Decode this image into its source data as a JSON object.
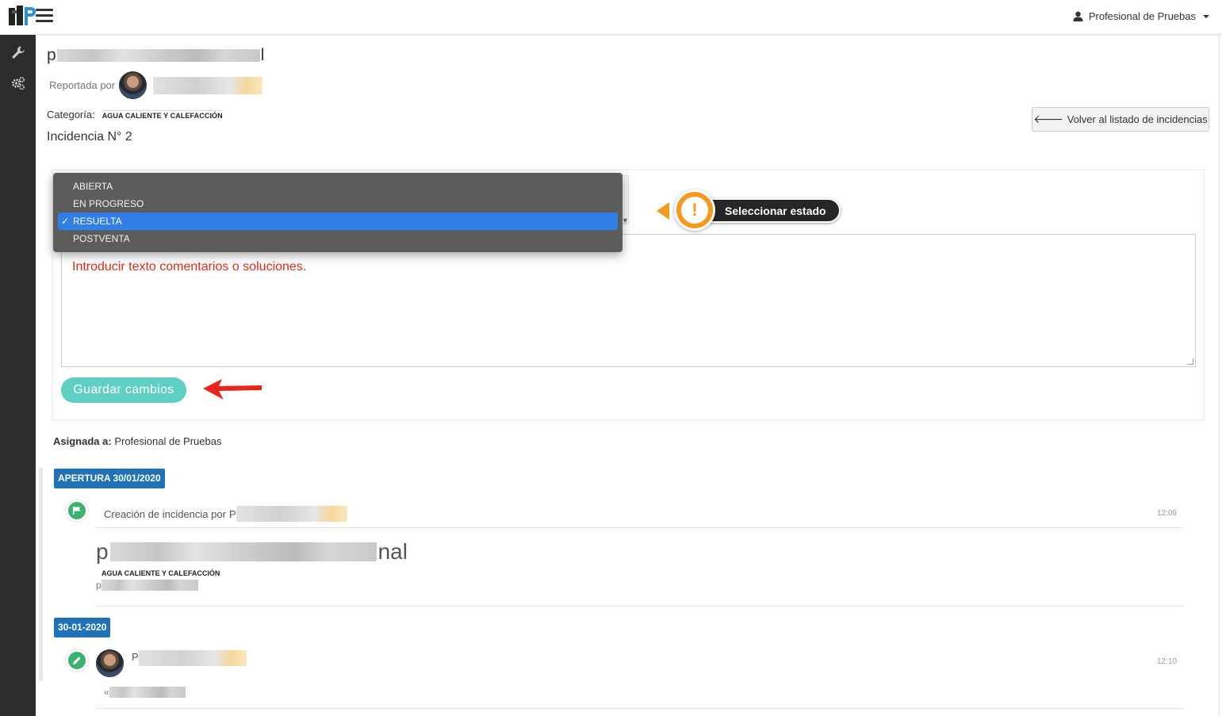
{
  "header": {
    "user_name": "Profesional de Pruebas",
    "logo_icon": "app-logo",
    "menu_icon": "hamburger-menu-icon",
    "user_icon": "user-icon"
  },
  "sidebar": {
    "items": [
      {
        "icon": "wrench-icon"
      },
      {
        "icon": "gears-icon"
      }
    ]
  },
  "incident": {
    "title_prefix": "p",
    "title_suffix": "l",
    "reported_label": "Reportada por",
    "category_label": "Categoría:",
    "category_value": "AGUA CALIENTE Y CALEFACCIÓN",
    "number_label": "Incidencia N° 2",
    "back_button": "Volver al listado de incidencias"
  },
  "status_dropdown": {
    "options": [
      "ABIERTA",
      "EN PROGRESO",
      "RESUELTA",
      "POSTVENTA"
    ],
    "selected": "RESUELTA",
    "check_mark": "✓"
  },
  "callout": {
    "label": "Seleccionar estado",
    "mark": "!",
    "color": "#f39a1f"
  },
  "comment": {
    "text": "Introducir texto comentarios o soluciones."
  },
  "save_button": "Guardar cambios",
  "assigned": {
    "label": "Asignada a:",
    "value": "Profesional de Pruebas"
  },
  "timeline": {
    "badge_open": "APERTURA 30/01/2020",
    "entry1": {
      "text": "Creación de incidencia por",
      "initial": "P",
      "time": "12:09",
      "title_prefix": "p",
      "title_suffix": "nal",
      "category": "AGUA CALIENTE Y CALEFACCIÓN",
      "desc_prefix": "p"
    },
    "badge_date": "30-01-2020",
    "entry2": {
      "initial": "P",
      "time": "12:10",
      "quote_prefix": "«"
    }
  },
  "colors": {
    "accent_save": "#5fcfc4",
    "badge_blue": "#1f72b8",
    "timeline_green": "#3bb273",
    "comment_red": "#e02a16",
    "dropdown_selected": "#2f7fe6"
  }
}
